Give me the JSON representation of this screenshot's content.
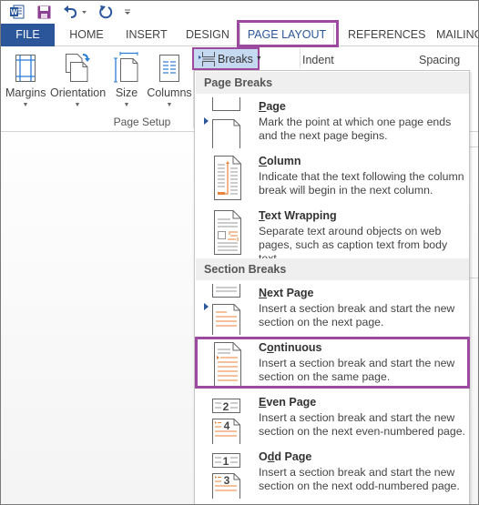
{
  "qat": {
    "icons": [
      "word-logo",
      "save-icon",
      "undo-icon",
      "redo-icon",
      "customize-qat-icon"
    ]
  },
  "tabs": [
    {
      "label": "FILE"
    },
    {
      "label": "HOME"
    },
    {
      "label": "INSERT"
    },
    {
      "label": "DESIGN"
    },
    {
      "label": "PAGE LAYOUT",
      "active": true
    },
    {
      "label": "REFERENCES"
    },
    {
      "label": "MAILINGS"
    }
  ],
  "ribbon": {
    "buttons": [
      {
        "label": "Margins"
      },
      {
        "label": "Orientation"
      },
      {
        "label": "Size"
      },
      {
        "label": "Columns"
      }
    ],
    "group_label": "Page Setup",
    "breaks_label": "Breaks",
    "indent_label": "Indent",
    "spacing_label": "Spacing"
  },
  "menu": {
    "sections": [
      {
        "heading": "Page Breaks",
        "items": [
          {
            "accel": "P",
            "rest": "age",
            "desc": "Mark the point at which one page ends and the next page begins."
          },
          {
            "accel": "C",
            "rest": "olumn",
            "desc": "Indicate that the text following the column break will begin in the next column."
          },
          {
            "accel": "T",
            "rest": "ext Wrapping",
            "desc": "Separate text around objects on web pages, such as caption text from body text."
          }
        ]
      },
      {
        "heading": "Section Breaks",
        "items": [
          {
            "accel": "N",
            "rest": "ext Page",
            "desc": "Insert a section break and start the new section on the next page."
          },
          {
            "pre": "C",
            "accel": "o",
            "rest": "ntinuous",
            "desc": "Insert a section break and start the new section on the same page.",
            "highlighted": true
          },
          {
            "accel": "E",
            "rest": "ven Page",
            "desc": "Insert a section break and start the new section on the next even-numbered page.",
            "num_top": "2",
            "num_bottom": "4"
          },
          {
            "pre": "O",
            "accel": "d",
            "rest": "d Page",
            "desc": "Insert a section break and start the new section on the next odd-numbered page.",
            "num_top": "1",
            "num_bottom": "3"
          }
        ]
      }
    ]
  },
  "colors": {
    "file_tab": "#2b579a",
    "highlight": "#9b4aa0",
    "breaks_hover": "#c5d9f1",
    "icon_orange": "#e8833a"
  }
}
